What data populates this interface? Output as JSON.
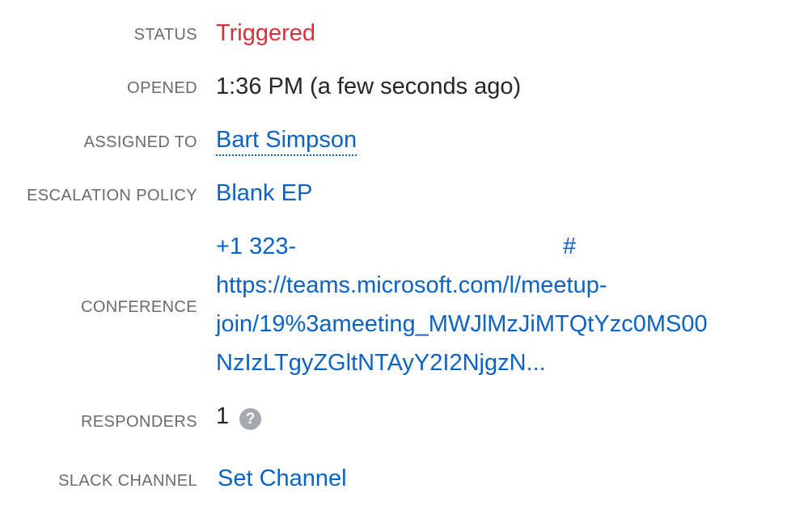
{
  "fields": {
    "status": {
      "label": "STATUS",
      "value": "Triggered",
      "color": "#d9303a"
    },
    "opened": {
      "label": "OPENED",
      "value": "1:36 PM (a few seconds ago)"
    },
    "assigned_to": {
      "label": "ASSIGNED TO",
      "value": "Bart Simpson"
    },
    "escalation_policy": {
      "label": "ESCALATION POLICY",
      "value": "Blank EP"
    },
    "conference": {
      "label": "CONFERENCE",
      "phone": "+1 323-",
      "phone_suffix": "#",
      "url_lines": [
        "https://teams.microsoft.com/l/meetup-",
        "join/19%3ameeting_MWJlMzJiMTQtYzc0MS00",
        "NzIzLTgyZGltNTAyY2I2NjgzN..."
      ]
    },
    "responders": {
      "label": "RESPONDERS",
      "value": "1",
      "help_icon": "question-mark-icon",
      "help_glyph": "?"
    },
    "slack_channel": {
      "label": "SLACK CHANNEL",
      "value": "Set Channel"
    }
  },
  "colors": {
    "link": "#0b63c4",
    "label": "#6b6b6b",
    "text": "#262626",
    "icon_bg": "#a4a9b0"
  }
}
